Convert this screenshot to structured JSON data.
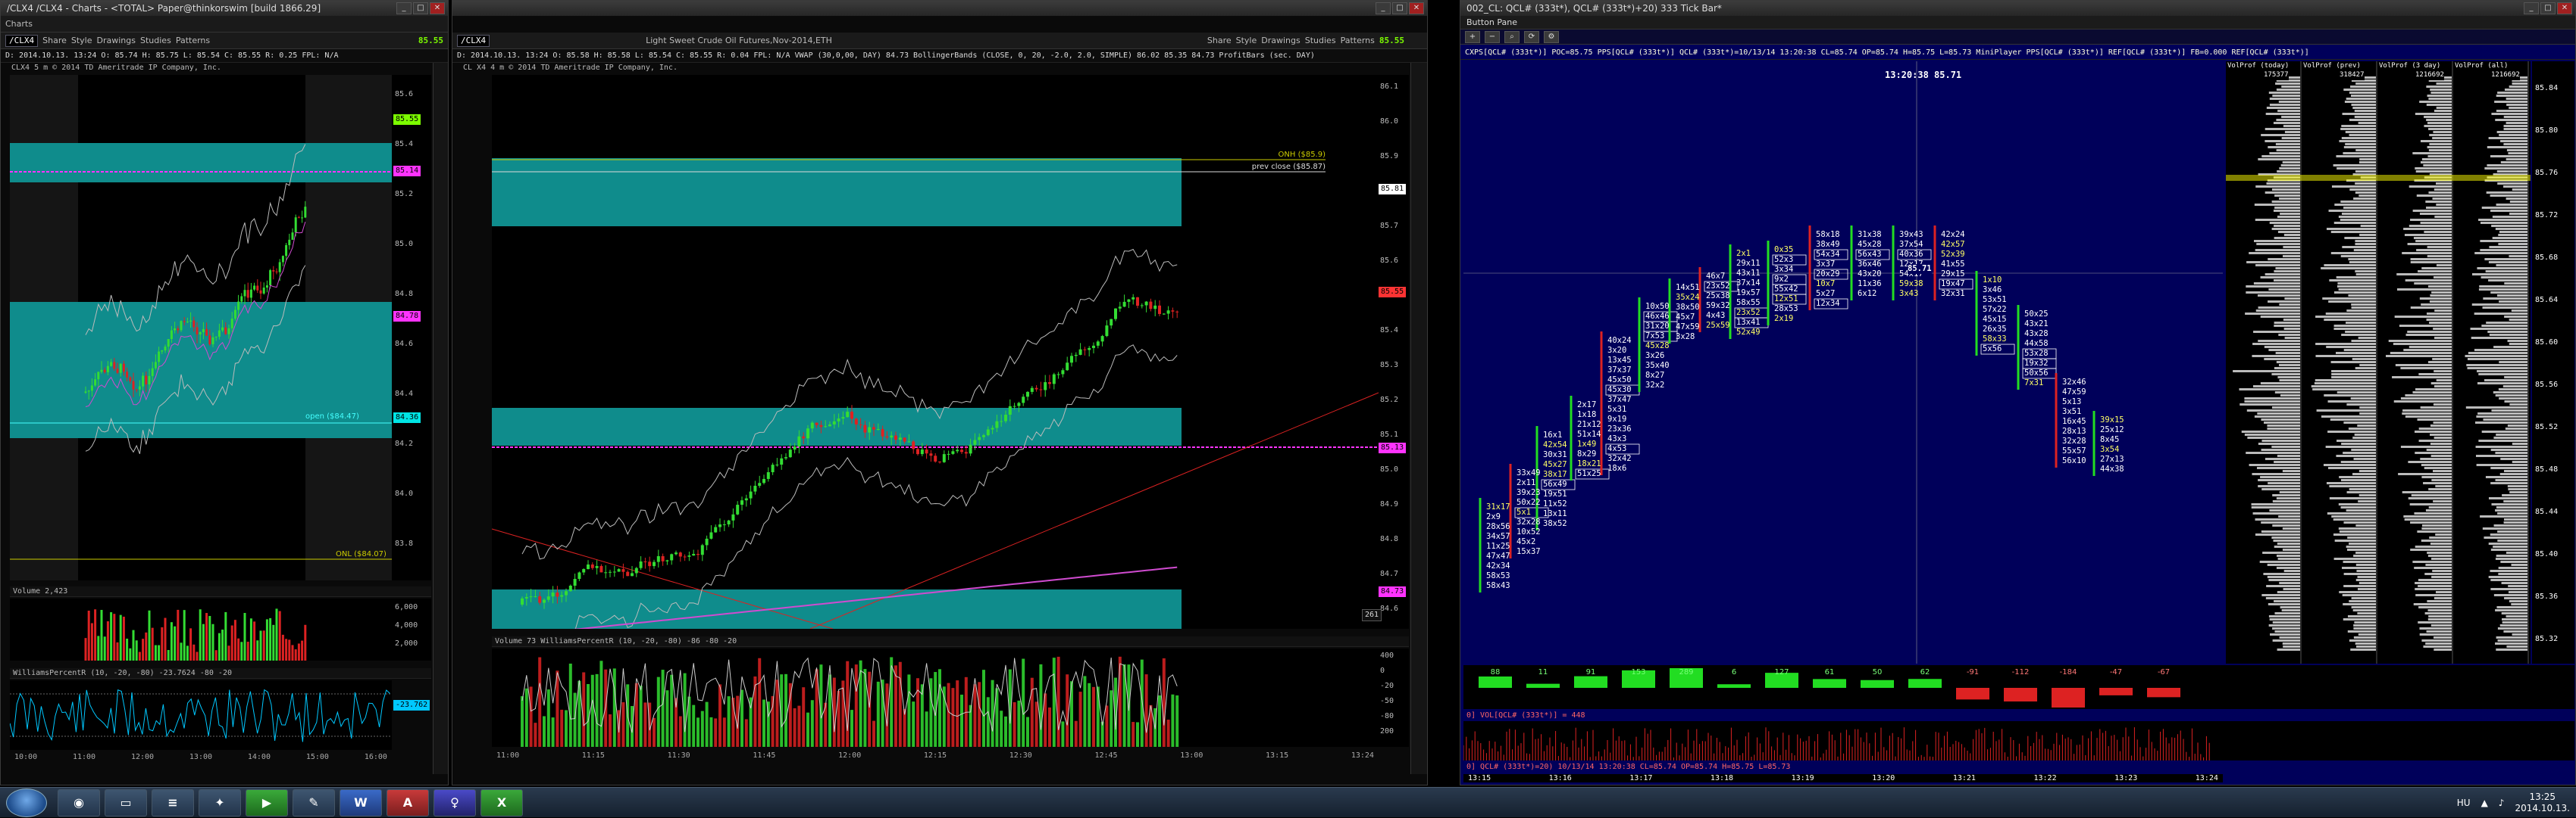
{
  "win1": {
    "title": "/CLX4 /CLX4 - Charts - <TOTAL> Paper@thinkorswim [build 1866.29]",
    "tab": "Charts",
    "symbol": "/CLX4",
    "share": "Share",
    "style": "Style",
    "drawings": "Drawings",
    "studies": "Studies",
    "patterns": "Patterns",
    "last_price": "85.55",
    "quote": "D: 2014.10.13. 13:24   O: 85.74   H: 85.75   L: 85.54   C: 85.55   R: 0.25   FPL: N/A",
    "copyright": "CLX4 5 m   © 2014 TD Ameritrade IP Company, Inc.",
    "price_ticks": [
      "85.6",
      "85.4",
      "85.2",
      "85.0",
      "84.8",
      "84.6",
      "84.4",
      "84.2",
      "84.0",
      "83.8"
    ],
    "tags": {
      "t1": "85.14",
      "t2": "84.78",
      "t3": "84.36",
      "t4": "85.55"
    },
    "labels": {
      "open": "open ($84.47)",
      "onl": "ONL ($84.07)"
    },
    "volume_label": "Volume   2,423",
    "vol_ticks": [
      "6,000",
      "4,000",
      "2,000"
    ],
    "wpr_label": "WilliamsPercentR (10, -20, -80)   -23.7624   -80   -20",
    "wpr_tag": "-23.762",
    "times": [
      "10:00",
      "11:00",
      "12:00",
      "13:00",
      "14:00",
      "15:00",
      "16:00"
    ]
  },
  "win2": {
    "symbol": "/CLX4",
    "copyright": "CL X4 4 m   © 2014 TD Ameritrade IP Company, Inc.",
    "contract": "Light Sweet Crude Oil Futures,Nov-2014,ETH",
    "share": "Share",
    "style": "Style",
    "drawings": "Drawings",
    "studies": "Studies",
    "patterns": "Patterns",
    "last_price": "85.55",
    "quote": "D: 2014.10.13. 13:24   O: 85.58   H: 85.58   L: 85.54   C: 85.55   R: 0.04   FPL: N/A   VWAP (30,0,00, DAY)  84.73   BollingerBands (CLOSE, 0, 20, -2.0, 2.0, SIMPLE)  86.02  85.35  84.73  ProfitBars (sec. DAY)",
    "price_ticks": [
      "86.1",
      "86.0",
      "85.9",
      "85.8",
      "85.7",
      "85.6",
      "85.5",
      "85.4",
      "85.3",
      "85.2",
      "85.1",
      "85.0",
      "84.9",
      "84.8",
      "84.7",
      "84.6"
    ],
    "tags": {
      "t1": "85.81",
      "t2": "85.55",
      "t3": "85.13",
      "t4": "84.73"
    },
    "labels": {
      "onh": "ONH ($85.9)",
      "prev": "prev close ($85.87)"
    },
    "bar_count": "261",
    "volume_label": "Volume   73   WilliamsPercentR (10, -20, -80)   -86   -80   -20",
    "wpr_ticks": [
      "400",
      "0",
      "-20",
      "-50",
      "-80",
      "200"
    ],
    "times": [
      "11:00",
      "11:15",
      "11:30",
      "11:45",
      "12:00",
      "12:15",
      "12:30",
      "12:45",
      "13:00",
      "13:15",
      "13:24"
    ]
  },
  "win3": {
    "title": "002_CL: QCL# (333t*), QCL# (333t*)+20) 333 Tick Bar*",
    "pane": "Button Pane",
    "legend": "CXPS[QCL# (333t*)] POC=85.75  PPS[QCL# (333t*)]  QCL# (333t*)=10/13/14 13:20:38 CL=85.74 OP=85.74 H=85.75 L=85.73  MiniPlayer  PPS[QCL# (333t*)]  REF[QCL# (333t*)] FB=0.000  REF[QCL# (333t*)]",
    "crosshair": "13:20:38  85.71",
    "cur_price": "85.71",
    "vp_headers": [
      "VolProf (today)",
      "VolProf (prev)",
      "VolProf (3 day)",
      "VolProf (all)"
    ],
    "vp_vals": [
      "175377",
      "318427",
      "1216692",
      "1216692"
    ],
    "price_ticks": [
      "85.84",
      "85.80",
      "85.76",
      "85.72",
      "85.68",
      "85.64",
      "85.60",
      "85.56",
      "85.52",
      "85.48",
      "85.44",
      "85.40",
      "85.36",
      "85.32"
    ],
    "delta": [
      "88",
      "11",
      "91",
      "153",
      "289",
      "6",
      "127",
      "61",
      "50",
      "62",
      "-91",
      "-112",
      "-184",
      "-47",
      "-67"
    ],
    "pane2": "0] VOL[QCL# (333t*)] = 448",
    "pane3": "0] QCL# (333t*)=20) 10/13/14 13:20:38 CL=85.74 OP=85.74 H=85.75 L=85.73",
    "times": [
      "13:15",
      "13:16",
      "13:17",
      "13:18",
      "13:19",
      "13:20",
      "13:21",
      "13:22",
      "13:23",
      "13:24"
    ],
    "bottom_tag": "002_CL"
  },
  "taskbar": {
    "lang": "HU",
    "time": "13:25",
    "date": "2014.10.13."
  }
}
